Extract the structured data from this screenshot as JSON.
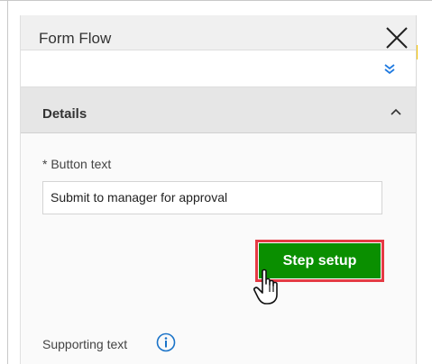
{
  "panel": {
    "title": "Form Flow",
    "close_icon": "close-icon",
    "expand_icon": "double-chevron-down-icon"
  },
  "details": {
    "title": "Details",
    "toggle_icon": "caret-up-icon"
  },
  "form": {
    "button_text_label": "* Button text",
    "button_text_value": "Submit to manager for approval",
    "step_setup_label": "Step setup",
    "supporting_text_label": "Supporting text",
    "info_icon": "info-icon"
  },
  "colors": {
    "primary_button": "#0a8f00",
    "highlight_outline": "#e53a44",
    "info_blue": "#1a73c8",
    "expand_blue": "#1f7ae0"
  }
}
